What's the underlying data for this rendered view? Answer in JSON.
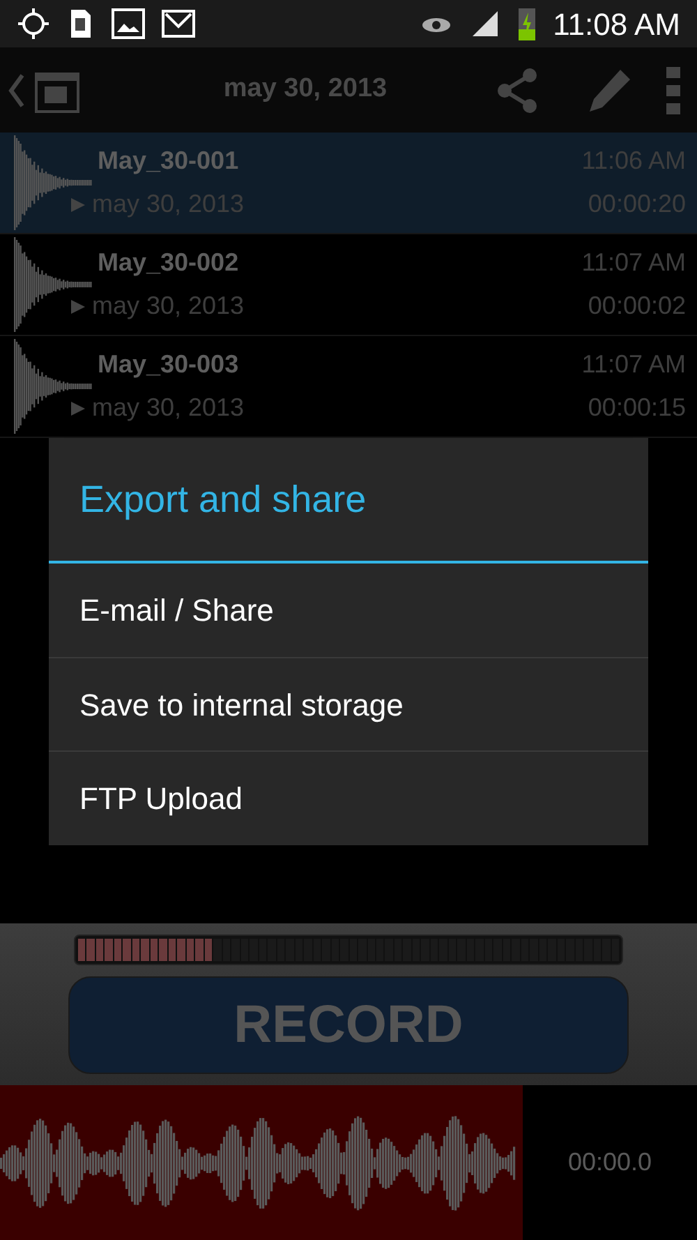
{
  "status_bar": {
    "time": "11:08 AM"
  },
  "action_bar": {
    "title": "may 30, 2013"
  },
  "recordings": [
    {
      "name": "May_30-001",
      "date": "may 30, 2013",
      "time": "11:06 AM",
      "duration": "00:00:20",
      "selected": true
    },
    {
      "name": "May_30-002",
      "date": "may 30, 2013",
      "time": "11:07 AM",
      "duration": "00:00:02",
      "selected": false
    },
    {
      "name": "May_30-003",
      "date": "may 30, 2013",
      "time": "11:07 AM",
      "duration": "00:00:15",
      "selected": false
    }
  ],
  "dialog": {
    "title": "Export and share",
    "items": [
      "E-mail / Share",
      "Save to internal storage",
      "FTP Upload"
    ]
  },
  "recorder": {
    "meter": {
      "level": 0.25
    },
    "button": "RECORD",
    "elapsed": "00:00.0"
  }
}
